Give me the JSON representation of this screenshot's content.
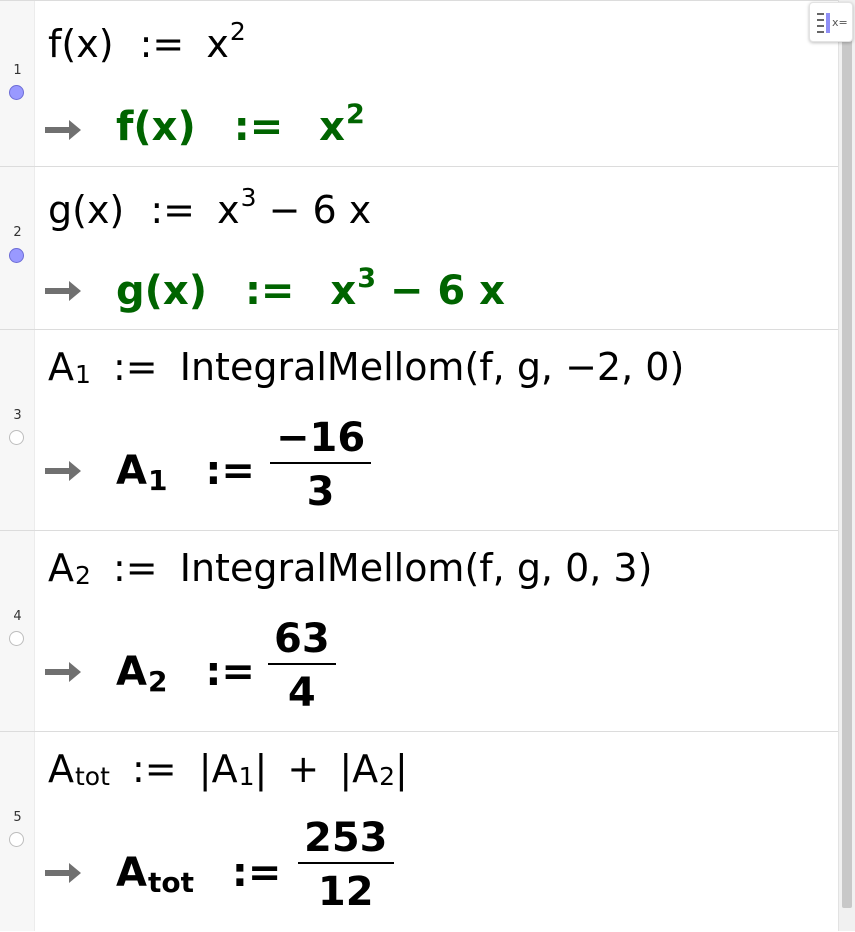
{
  "rows": [
    {
      "number": "1",
      "visible": true,
      "input": {
        "fn": "f(x)",
        "op": ":=",
        "base": "x",
        "exp": "2",
        "rest": ""
      },
      "output": {
        "fn": "f(x)",
        "op": ":=",
        "base": "x",
        "exp": "2",
        "rest": "",
        "color": "#006400"
      }
    },
    {
      "number": "2",
      "visible": true,
      "input": {
        "fn": "g(x)",
        "op": ":=",
        "base": "x",
        "exp": "3",
        "rest": " − 6 x"
      },
      "output": {
        "fn": "g(x)",
        "op": ":=",
        "base": "x",
        "exp": "3",
        "rest": " − 6 x",
        "color": "#006400"
      }
    },
    {
      "number": "3",
      "visible": false,
      "input": {
        "var": "A",
        "sub": "1",
        "op": ":=",
        "expr": "IntegralMellom(f, g, −2, 0)"
      },
      "output": {
        "var": "A",
        "sub": "1",
        "op": ":=",
        "numerator": "−16",
        "denominator": "3"
      }
    },
    {
      "number": "4",
      "visible": false,
      "input": {
        "var": "A",
        "sub": "2",
        "op": ":=",
        "expr": "IntegralMellom(f, g, 0, 3)"
      },
      "output": {
        "var": "A",
        "sub": "2",
        "op": ":=",
        "numerator": "63",
        "denominator": "4"
      }
    },
    {
      "number": "5",
      "visible": false,
      "input": {
        "var": "A",
        "sub": "tot",
        "op": ":=",
        "abs1_var": "A",
        "abs1_sub": "1",
        "plus": "+",
        "abs2_var": "A",
        "abs2_sub": "2"
      },
      "output": {
        "var": "A",
        "sub": "tot",
        "op": ":=",
        "numerator": "253",
        "denominator": "12"
      }
    }
  ],
  "colors": {
    "visible_dot": "#9999ff",
    "output_green": "#006400",
    "arrow": "#707070",
    "separator": "#dcdcdc"
  },
  "icons": {
    "toggle": "algebra-input-toggle-icon",
    "arrow": "right-arrow-icon"
  },
  "toggle_label": "x="
}
